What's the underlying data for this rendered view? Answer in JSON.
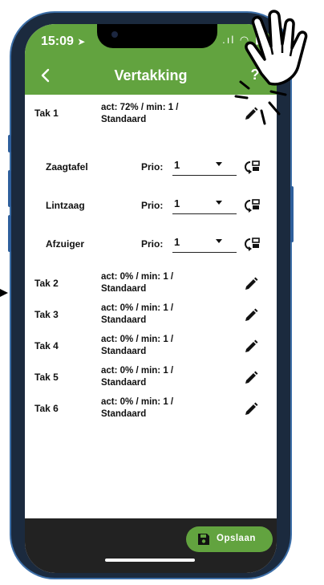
{
  "status_bar": {
    "time": "15:09",
    "signal": ".ıl",
    "wifi": "wifi",
    "battery": "battery"
  },
  "header": {
    "title": "Vertakking",
    "back_icon": "chevron-left-icon",
    "help_label": "?"
  },
  "taks": [
    {
      "name": "Tak 1",
      "status_line1": "act: 72% / min: 1 /",
      "status_line2": "Standaard"
    },
    {
      "name": "Tak 2",
      "status_line1": "act: 0% / min: 1 /",
      "status_line2": "Standaard"
    },
    {
      "name": "Tak 3",
      "status_line1": "act: 0% / min: 1 /",
      "status_line2": "Standaard"
    },
    {
      "name": "Tak 4",
      "status_line1": "act: 0% / min: 1 /",
      "status_line2": "Standaard"
    },
    {
      "name": "Tak 5",
      "status_line1": "act: 0% / min: 1 /",
      "status_line2": "Standaard"
    },
    {
      "name": "Tak 6",
      "status_line1": "act: 0% / min: 1 /",
      "status_line2": "Standaard"
    }
  ],
  "sub_items": [
    {
      "name": "Zaagtafel",
      "prio_label": "Prio:",
      "prio_value": "1"
    },
    {
      "name": "Lintzaag",
      "prio_label": "Prio:",
      "prio_value": "1"
    },
    {
      "name": "Afzuiger",
      "prio_label": "Prio:",
      "prio_value": "1"
    }
  ],
  "footer": {
    "save_label": "Opslaan"
  },
  "colors": {
    "accent": "#62a33f",
    "footer": "#222222",
    "frame": "#3d6fa8"
  }
}
